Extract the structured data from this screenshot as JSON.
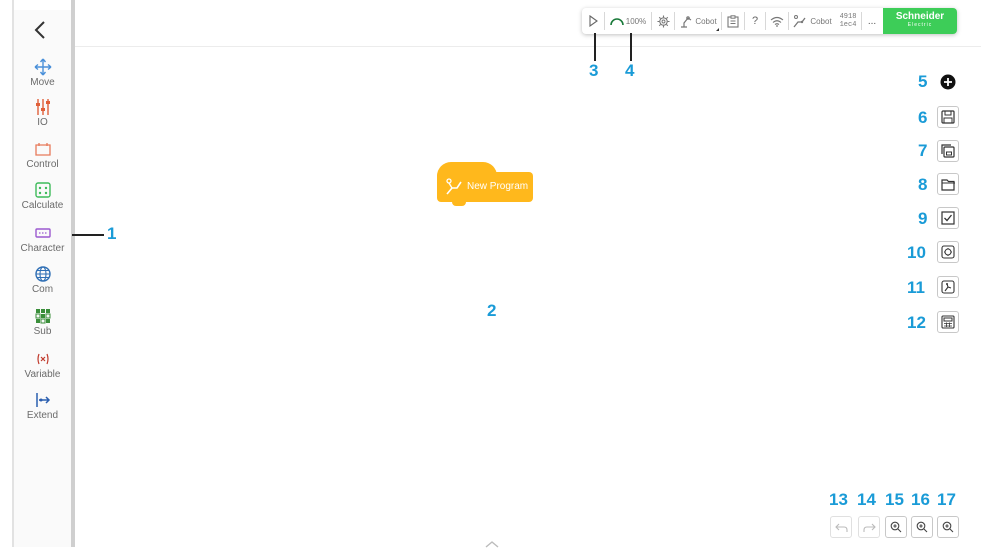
{
  "sidebar": {
    "back_icon": "chevron-left-icon",
    "items": [
      {
        "label": "Move",
        "icon": "move-arrows-icon",
        "color": "#4a90d9"
      },
      {
        "label": "IO",
        "icon": "io-sliders-icon",
        "color": "#e0603a"
      },
      {
        "label": "Control",
        "icon": "control-bracket-icon",
        "color": "#e87a5a"
      },
      {
        "label": "Calculate",
        "icon": "calculator-icon",
        "color": "#3dbb5a"
      },
      {
        "label": "Character",
        "icon": "character-box-icon",
        "color": "#9b59d0"
      },
      {
        "label": "Com",
        "icon": "globe-icon",
        "color": "#2f6fb5"
      },
      {
        "label": "Sub",
        "icon": "grid-icon",
        "color": "#3a8e3a"
      },
      {
        "label": "Variable",
        "icon": "variable-x-icon",
        "color": "#c0392b"
      },
      {
        "label": "Extend",
        "icon": "extend-icon",
        "color": "#2b5fb0"
      }
    ]
  },
  "toolbar": {
    "speed": "100%",
    "cobot1": "Cobot",
    "cobot2": "Cobot",
    "help": "?",
    "id_top": "4918",
    "id_bottom": "1ec4",
    "more": "..."
  },
  "brand": {
    "name": "Schneider",
    "sub": "Electric",
    "color": "#3dcd58"
  },
  "program_block": {
    "label": "New Program",
    "color": "#ffb81c"
  },
  "callouts": {
    "c1": "1",
    "c2": "2",
    "c3": "3",
    "c4": "4",
    "c5": "5",
    "c6": "6",
    "c7": "7",
    "c8": "8",
    "c9": "9",
    "c10": "10",
    "c11": "11",
    "c12": "12",
    "c13": "13",
    "c14": "14",
    "c15": "15",
    "c16": "16",
    "c17": "17"
  },
  "right_panel": {
    "icons": [
      "add-circle-icon",
      "save-icon",
      "save-as-icon",
      "folder-open-icon",
      "checkbox-icon",
      "safety-gear-icon",
      "robot-arm-icon",
      "calculator-panel-icon"
    ]
  },
  "zoom_bar": {
    "icons": [
      "undo-icon",
      "redo-icon",
      "zoom-in-icon",
      "zoom-in-icon",
      "zoom-in-icon"
    ]
  },
  "colors": {
    "accent": "#1a9bd7"
  }
}
